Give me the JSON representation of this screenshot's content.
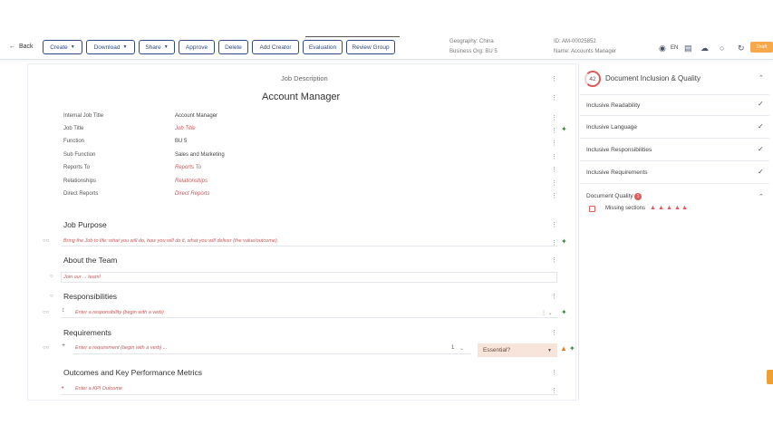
{
  "header": {
    "back_label": "Back",
    "buttons": [
      {
        "label": "Create",
        "dropdown": true
      },
      {
        "label": "Download",
        "dropdown": true
      },
      {
        "label": "Share",
        "dropdown": true
      },
      {
        "label": "Approve",
        "dropdown": false
      },
      {
        "label": "Delete",
        "dropdown": false
      },
      {
        "label": "Add Creator",
        "dropdown": false
      },
      {
        "label": "Evaluation",
        "dropdown": false
      },
      {
        "label": "Review Group",
        "dropdown": false
      }
    ],
    "geography": "Geography: China",
    "business_org": "Business Org: BU 5",
    "id": "ID: AM-00025852",
    "name": "Name: Accounts Manager",
    "lang": "EN",
    "status": "Draft"
  },
  "document": {
    "label": "Job Description",
    "title": "Account Manager",
    "fields": [
      {
        "label": "Internal Job Title",
        "value": "Account Manager",
        "placeholder": false
      },
      {
        "label": "Job Title",
        "value": "Job Title",
        "placeholder": true
      },
      {
        "label": "Function",
        "value": "BU 5",
        "placeholder": false
      },
      {
        "label": "Sub Function",
        "value": "Sales and Marketing",
        "placeholder": false
      },
      {
        "label": "Reports To",
        "value": "Reports To",
        "placeholder": true
      },
      {
        "label": "Relationships",
        "value": "Relationships",
        "placeholder": true
      },
      {
        "label": "Direct Reports",
        "value": "Direct Reports",
        "placeholder": true
      }
    ],
    "sections": {
      "job_purpose": {
        "title": "Job Purpose",
        "placeholder": "Bring the Job to life: what you will do, how you will do it, what you will deliver (the value/outcome)."
      },
      "about_team": {
        "title": "About the Team",
        "placeholder": "Join our ... team!"
      },
      "responsibilities": {
        "title": "Responsibilities",
        "placeholder": "Enter a responsibility (begin with a verb)"
      },
      "requirements": {
        "title": "Requirements",
        "placeholder": "Enter a requirement (begin with a verb) ...",
        "count": "1",
        "select": "Essential?"
      },
      "outcomes": {
        "title": "Outcomes and Key Performance Metrics",
        "placeholder": "Enter a KPI Outcome"
      }
    }
  },
  "panel": {
    "score": "42",
    "title": "Document Inclusion & Quality",
    "items": [
      {
        "label": "Inclusive Readability"
      },
      {
        "label": "Inclusive Language"
      },
      {
        "label": "Inclusive Responsibilities"
      },
      {
        "label": "Inclusive Requirements"
      }
    ],
    "quality": {
      "label": "Document Quality",
      "badge": "1",
      "missing_label": "Missing sections"
    }
  },
  "colors": {
    "accent": "#2f4a86",
    "warning": "#e05a5a",
    "draft": "#f6a84a"
  }
}
